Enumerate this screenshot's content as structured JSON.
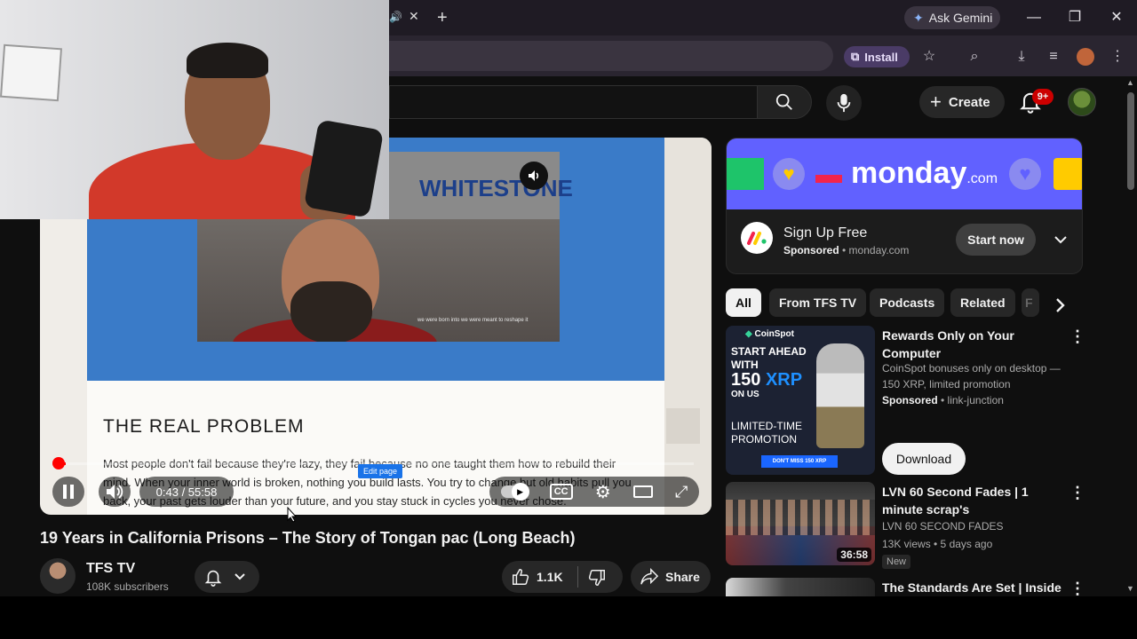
{
  "browser": {
    "ask_gemini": "Ask Gemini",
    "install_label": "Install"
  },
  "masthead": {
    "create_label": "Create",
    "notif_count": "9+"
  },
  "player": {
    "slide_brand": "WHITESTONE",
    "slide_subtitle": "we were born into we were meant to reshape it",
    "slide_heading": "THE REAL PROBLEM",
    "slide_body": "Most people don't fail because they're lazy, they fail because no one taught them how to rebuild their mind. When your inner world is broken, nothing you build lasts. You try to change but old habits pull you back, your past gets louder than your future, and you stay stuck in cycles you never chose.",
    "edit_page": "Edit page",
    "time": "0:43 / 55:58",
    "progress_fraction": 0.013
  },
  "video": {
    "title": "19 Years in California Prisons – The Story of Tongan pac (Long Beach)",
    "channel_name": "TFS TV",
    "subscribers": "108K subscribers",
    "likes": "1.1K",
    "share_label": "Share"
  },
  "ad": {
    "logo": "monday",
    "logo_suffix": ".com",
    "title": "Sign Up Free",
    "sponsored": "Sponsored",
    "domain": "monday.com",
    "cta": "Start now"
  },
  "chips": [
    {
      "label": "All"
    },
    {
      "label": "From TFS TV"
    },
    {
      "label": "Podcasts"
    },
    {
      "label": "Related"
    },
    {
      "label": "F"
    }
  ],
  "recommendations": [
    {
      "title": "Rewards Only on Your Computer",
      "desc": "CoinSpot bonuses only on desktop — 150 XRP, limited promotion",
      "sponsored": "Sponsored",
      "source": "link-junction",
      "cta": "Download",
      "thumb_brand": "CoinSpot",
      "thumb_line1": "START AHEAD",
      "thumb_line2": "WITH",
      "thumb_amount": "150",
      "thumb_coin": "XRP",
      "thumb_onus": "ON US",
      "thumb_promo": "LIMITED-TIME PROMOTION",
      "thumb_button": "DON'T MISS 150 XRP"
    },
    {
      "title": "LVN 60 Second Fades | 1 minute scrap's",
      "channel": "LVN 60 SECOND FADES",
      "meta": "13K views • 5 days ago",
      "badge": "New",
      "duration": "36:58"
    },
    {
      "title": "The Standards Are Set | Inside"
    }
  ]
}
